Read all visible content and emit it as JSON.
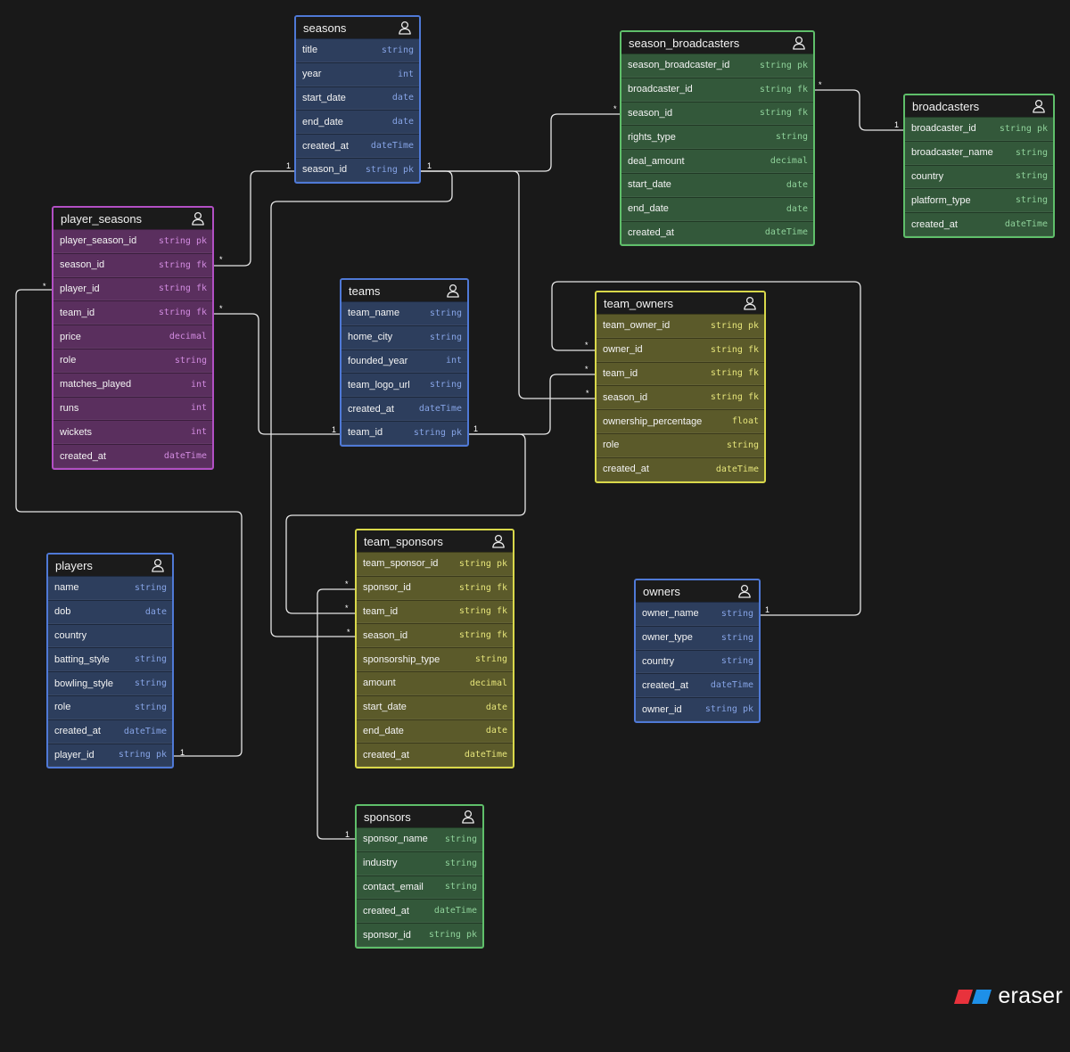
{
  "relationships": [
    {
      "from": "player_seasons.season_id",
      "to": "seasons.season_id",
      "from_card": "*",
      "to_card": "1"
    },
    {
      "from": "player_seasons.player_id",
      "to": "players.player_id",
      "from_card": "*",
      "to_card": "1"
    },
    {
      "from": "player_seasons.team_id",
      "to": "teams.team_id",
      "from_card": "*",
      "to_card": "1"
    },
    {
      "from": "season_broadcasters.season_id",
      "to": "seasons.season_id",
      "from_card": "*",
      "to_card": "1"
    },
    {
      "from": "season_broadcasters.season_broadcaster_id",
      "to": "broadcasters.broadcaster_id",
      "from_card": "*",
      "to_card": "1"
    },
    {
      "from": "team_owners.owner_id",
      "to": "owners.owner_id",
      "from_card": "*",
      "to_card": "1"
    },
    {
      "from": "team_owners.team_id",
      "to": "teams.team_id",
      "from_card": "*",
      "to_card": "1"
    },
    {
      "from": "team_owners.season_id",
      "to": "seasons.season_id",
      "from_card": "*",
      "to_card": "1"
    },
    {
      "from": "team_sponsors.sponsor_id",
      "to": "sponsors.sponsor_name",
      "from_card": "*",
      "to_card": "1"
    },
    {
      "from": "team_sponsors.team_id",
      "to": "teams.team_id",
      "from_card": "*",
      "to_card": "1"
    },
    {
      "from": "team_sponsors.season_id",
      "to": "seasons.season_id",
      "from_card": "*",
      "to_card": "1"
    }
  ],
  "entities": {
    "seasons": {
      "title": "seasons",
      "color": "blue",
      "icon": "user-icon",
      "fields": [
        {
          "name": "title",
          "type": "string",
          "key": ""
        },
        {
          "name": "year",
          "type": "int",
          "key": ""
        },
        {
          "name": "start_date",
          "type": "date",
          "key": ""
        },
        {
          "name": "end_date",
          "type": "date",
          "key": ""
        },
        {
          "name": "created_at",
          "type": "dateTime",
          "key": ""
        },
        {
          "name": "season_id",
          "type": "string",
          "key": "pk"
        }
      ]
    },
    "season_broadcasters": {
      "title": "season_broadcasters",
      "color": "green",
      "icon": "user-icon",
      "fields": [
        {
          "name": "season_broadcaster_id",
          "type": "string",
          "key": "pk"
        },
        {
          "name": "broadcaster_id",
          "type": "string",
          "key": "fk"
        },
        {
          "name": "season_id",
          "type": "string",
          "key": "fk"
        },
        {
          "name": "rights_type",
          "type": "string",
          "key": ""
        },
        {
          "name": "deal_amount",
          "type": "decimal",
          "key": ""
        },
        {
          "name": "start_date",
          "type": "date",
          "key": ""
        },
        {
          "name": "end_date",
          "type": "date",
          "key": ""
        },
        {
          "name": "created_at",
          "type": "dateTime",
          "key": ""
        }
      ]
    },
    "broadcasters": {
      "title": "broadcasters",
      "color": "green",
      "icon": "user-icon",
      "fields": [
        {
          "name": "broadcaster_id",
          "type": "string",
          "key": "pk"
        },
        {
          "name": "broadcaster_name",
          "type": "string",
          "key": ""
        },
        {
          "name": "country",
          "type": "string",
          "key": ""
        },
        {
          "name": "platform_type",
          "type": "string",
          "key": ""
        },
        {
          "name": "created_at",
          "type": "dateTime",
          "key": ""
        }
      ]
    },
    "player_seasons": {
      "title": "player_seasons",
      "color": "purple",
      "icon": "user-icon",
      "fields": [
        {
          "name": "player_season_id",
          "type": "string",
          "key": "pk"
        },
        {
          "name": "season_id",
          "type": "string",
          "key": "fk"
        },
        {
          "name": "player_id",
          "type": "string",
          "key": "fk"
        },
        {
          "name": "team_id",
          "type": "string",
          "key": "fk"
        },
        {
          "name": "price",
          "type": "decimal",
          "key": ""
        },
        {
          "name": "role",
          "type": "string",
          "key": ""
        },
        {
          "name": "matches_played",
          "type": "int",
          "key": ""
        },
        {
          "name": "runs",
          "type": "int",
          "key": ""
        },
        {
          "name": "wickets",
          "type": "int",
          "key": ""
        },
        {
          "name": "created_at",
          "type": "dateTime",
          "key": ""
        }
      ]
    },
    "teams": {
      "title": "teams",
      "color": "blue",
      "icon": "user-icon",
      "fields": [
        {
          "name": "team_name",
          "type": "string",
          "key": ""
        },
        {
          "name": "home_city",
          "type": "string",
          "key": ""
        },
        {
          "name": "founded_year",
          "type": "int",
          "key": ""
        },
        {
          "name": "team_logo_url",
          "type": "string",
          "key": ""
        },
        {
          "name": "created_at",
          "type": "dateTime",
          "key": ""
        },
        {
          "name": "team_id",
          "type": "string",
          "key": "pk"
        }
      ]
    },
    "team_owners": {
      "title": "team_owners",
      "color": "yellow",
      "icon": "user-icon",
      "fields": [
        {
          "name": "team_owner_id",
          "type": "string",
          "key": "pk"
        },
        {
          "name": "owner_id",
          "type": "string",
          "key": "fk"
        },
        {
          "name": "team_id",
          "type": "string",
          "key": "fk"
        },
        {
          "name": "season_id",
          "type": "string",
          "key": "fk"
        },
        {
          "name": "ownership_percentage",
          "type": "float",
          "key": ""
        },
        {
          "name": "role",
          "type": "string",
          "key": ""
        },
        {
          "name": "created_at",
          "type": "dateTime",
          "key": ""
        }
      ]
    },
    "players": {
      "title": "players",
      "color": "blue",
      "icon": "user-icon",
      "fields": [
        {
          "name": "name",
          "type": "string",
          "key": ""
        },
        {
          "name": "dob",
          "type": "date",
          "key": ""
        },
        {
          "name": "country",
          "type": "",
          "key": ""
        },
        {
          "name": "batting_style",
          "type": "string",
          "key": ""
        },
        {
          "name": "bowling_style",
          "type": "string",
          "key": ""
        },
        {
          "name": "role",
          "type": "string",
          "key": ""
        },
        {
          "name": "created_at",
          "type": "dateTime",
          "key": ""
        },
        {
          "name": "player_id",
          "type": "string",
          "key": "pk"
        }
      ]
    },
    "team_sponsors": {
      "title": "team_sponsors",
      "color": "yellow",
      "icon": "user-icon",
      "fields": [
        {
          "name": "team_sponsor_id",
          "type": "string",
          "key": "pk"
        },
        {
          "name": "sponsor_id",
          "type": "string",
          "key": "fk"
        },
        {
          "name": "team_id",
          "type": "string",
          "key": "fk"
        },
        {
          "name": "season_id",
          "type": "string",
          "key": "fk"
        },
        {
          "name": "sponsorship_type",
          "type": "string",
          "key": ""
        },
        {
          "name": "amount",
          "type": "decimal",
          "key": ""
        },
        {
          "name": "start_date",
          "type": "date",
          "key": ""
        },
        {
          "name": "end_date",
          "type": "date",
          "key": ""
        },
        {
          "name": "created_at",
          "type": "dateTime",
          "key": ""
        }
      ]
    },
    "owners": {
      "title": "owners",
      "color": "blue",
      "icon": "user-icon",
      "fields": [
        {
          "name": "owner_name",
          "type": "string",
          "key": ""
        },
        {
          "name": "owner_type",
          "type": "string",
          "key": ""
        },
        {
          "name": "country",
          "type": "string",
          "key": ""
        },
        {
          "name": "created_at",
          "type": "dateTime",
          "key": ""
        },
        {
          "name": "owner_id",
          "type": "string",
          "key": "pk"
        }
      ]
    },
    "sponsors": {
      "title": "sponsors",
      "color": "green",
      "icon": "user-icon",
      "fields": [
        {
          "name": "sponsor_name",
          "type": "string",
          "key": ""
        },
        {
          "name": "industry",
          "type": "string",
          "key": ""
        },
        {
          "name": "contact_email",
          "type": "string",
          "key": ""
        },
        {
          "name": "created_at",
          "type": "dateTime",
          "key": ""
        },
        {
          "name": "sponsor_id",
          "type": "string",
          "key": "pk"
        }
      ]
    }
  },
  "colors": {
    "background": "#191919",
    "connector": "#e6e6e6",
    "logo_red": "#e8323c",
    "logo_blue": "#1e90e8"
  },
  "brand": {
    "name": "eraser",
    "icon": "eraser-logo-icon"
  }
}
